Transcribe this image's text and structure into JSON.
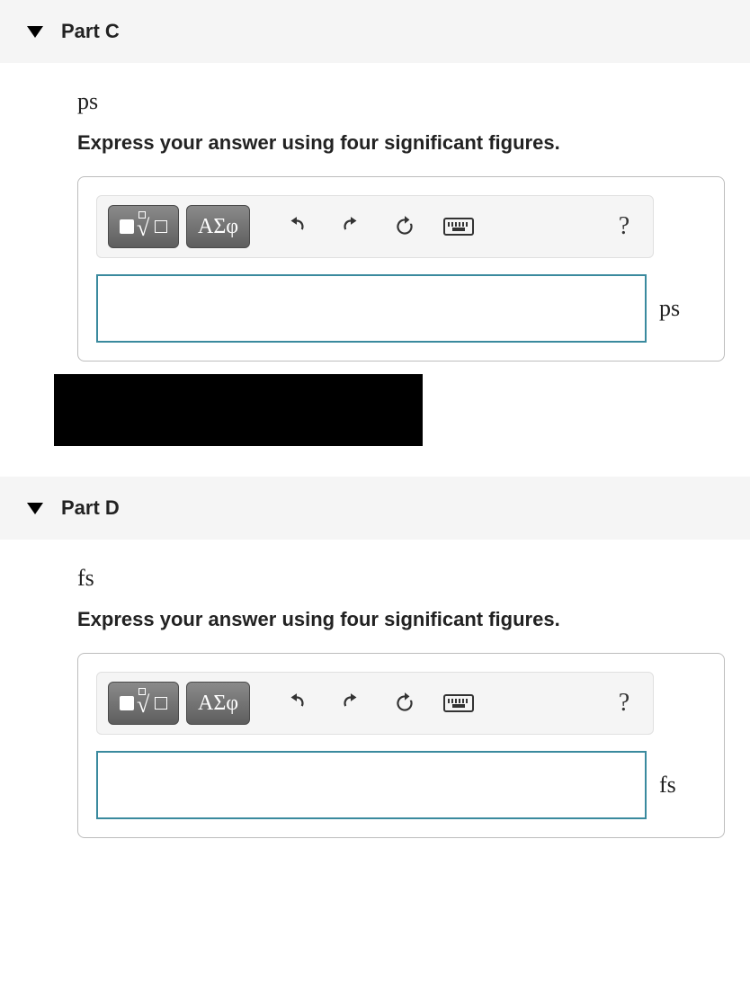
{
  "parts": [
    {
      "title": "Part C",
      "prompt_symbol": "ps",
      "instruction": "Express your answer using four significant figures.",
      "unit_suffix": "ps",
      "blackout_after": true
    },
    {
      "title": "Part D",
      "prompt_symbol": "fs",
      "instruction": "Express your answer using four significant figures.",
      "unit_suffix": "fs",
      "blackout_after": false
    }
  ],
  "toolbar": {
    "greek_label": "ΑΣφ",
    "help_label": "?"
  }
}
